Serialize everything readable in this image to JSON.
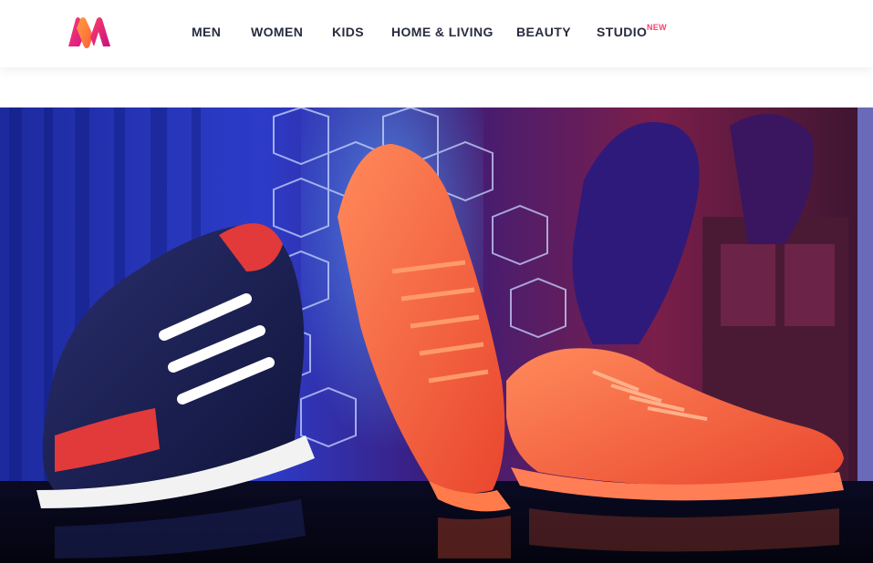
{
  "header": {
    "logo_icon": "myntra-logo-icon",
    "nav": [
      {
        "label": "MEN"
      },
      {
        "label": "WOMEN"
      },
      {
        "label": "KIDS"
      },
      {
        "label": "HOME & LIVING"
      },
      {
        "label": "BEAUTY"
      },
      {
        "label": "STUDIO",
        "badge": "NEW"
      }
    ]
  },
  "banner": {
    "image": "sneakers-product-photo",
    "colors": {
      "brand_pink": "#ff3f6c",
      "nav_text": "#282c3f",
      "backdrop_blue": "#1c2aa8",
      "orange_shoe": "#ff6a3d"
    }
  }
}
